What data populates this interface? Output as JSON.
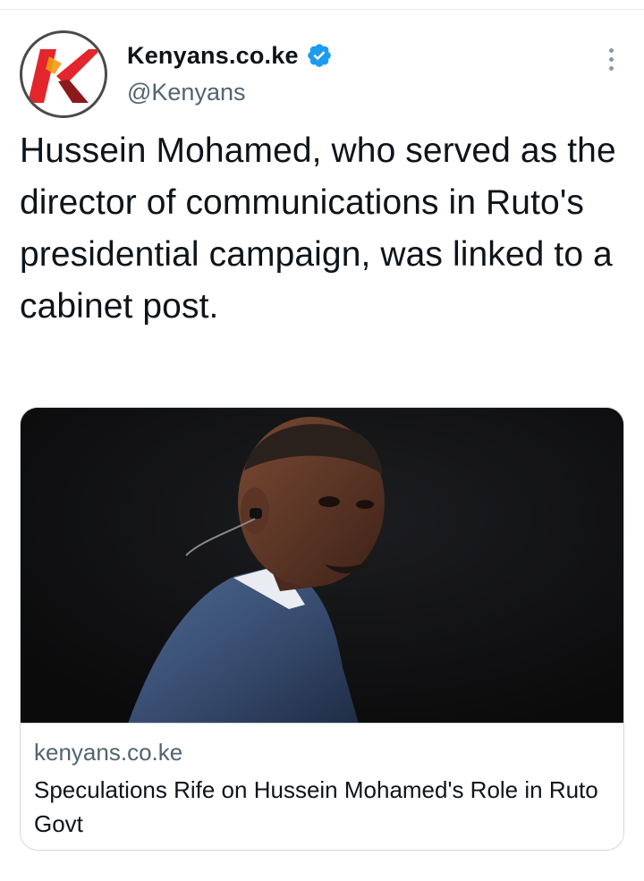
{
  "author": {
    "name": "Kenyans.co.ke",
    "handle": "@Kenyans",
    "verified": true,
    "avatar_icon": "kenyans-k-logo-icon",
    "brand_colors": {
      "red": "#e3262b",
      "dark_red": "#8c1a1d",
      "orange": "#f39c12"
    }
  },
  "tweet": {
    "text": "Hussein Mohamed, who served as the director of communications in Ruto's presidential campaign, was linked to a cabinet post."
  },
  "link_card": {
    "domain": "kenyans.co.ke",
    "title": "Speculations Rife on Hussein Mohamed's Role in Ruto Govt",
    "image_icon": "article-photo-man-in-suit"
  },
  "icons": {
    "verified": "verified-badge-icon",
    "more": "more-options-icon"
  },
  "colors": {
    "verified_blue": "#1d9bf0",
    "secondary_text": "#536471",
    "border": "#cfd9de"
  }
}
